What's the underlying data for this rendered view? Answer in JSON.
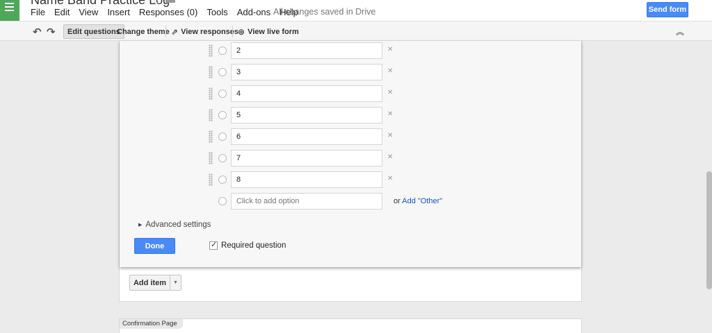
{
  "header": {
    "doc_title": "Name Band Practice Log",
    "menu": [
      "File",
      "Edit",
      "View",
      "Insert",
      "Responses (0)",
      "Tools",
      "Add-ons",
      "Help"
    ],
    "save_status": "All changes saved in Drive",
    "send_label": "Send form"
  },
  "toolbar": {
    "edit_questions": "Edit questions",
    "change_theme": "Change theme",
    "view_responses": "View responses",
    "view_live": "View live form"
  },
  "question": {
    "options": [
      "2",
      "3",
      "4",
      "5",
      "6",
      "7",
      "8"
    ],
    "add_option_placeholder": "Click to add option",
    "or_text": "or ",
    "add_other": "Add \"Other\"",
    "advanced_settings": "Advanced settings",
    "done_label": "Done",
    "required_label": "Required question",
    "required_checked": true
  },
  "add_item_label": "Add item",
  "confirmation_label": "Confirmation Page",
  "colors": {
    "accent": "#4a8af4",
    "logo_green": "#4fa75a",
    "link": "#1155cc"
  }
}
